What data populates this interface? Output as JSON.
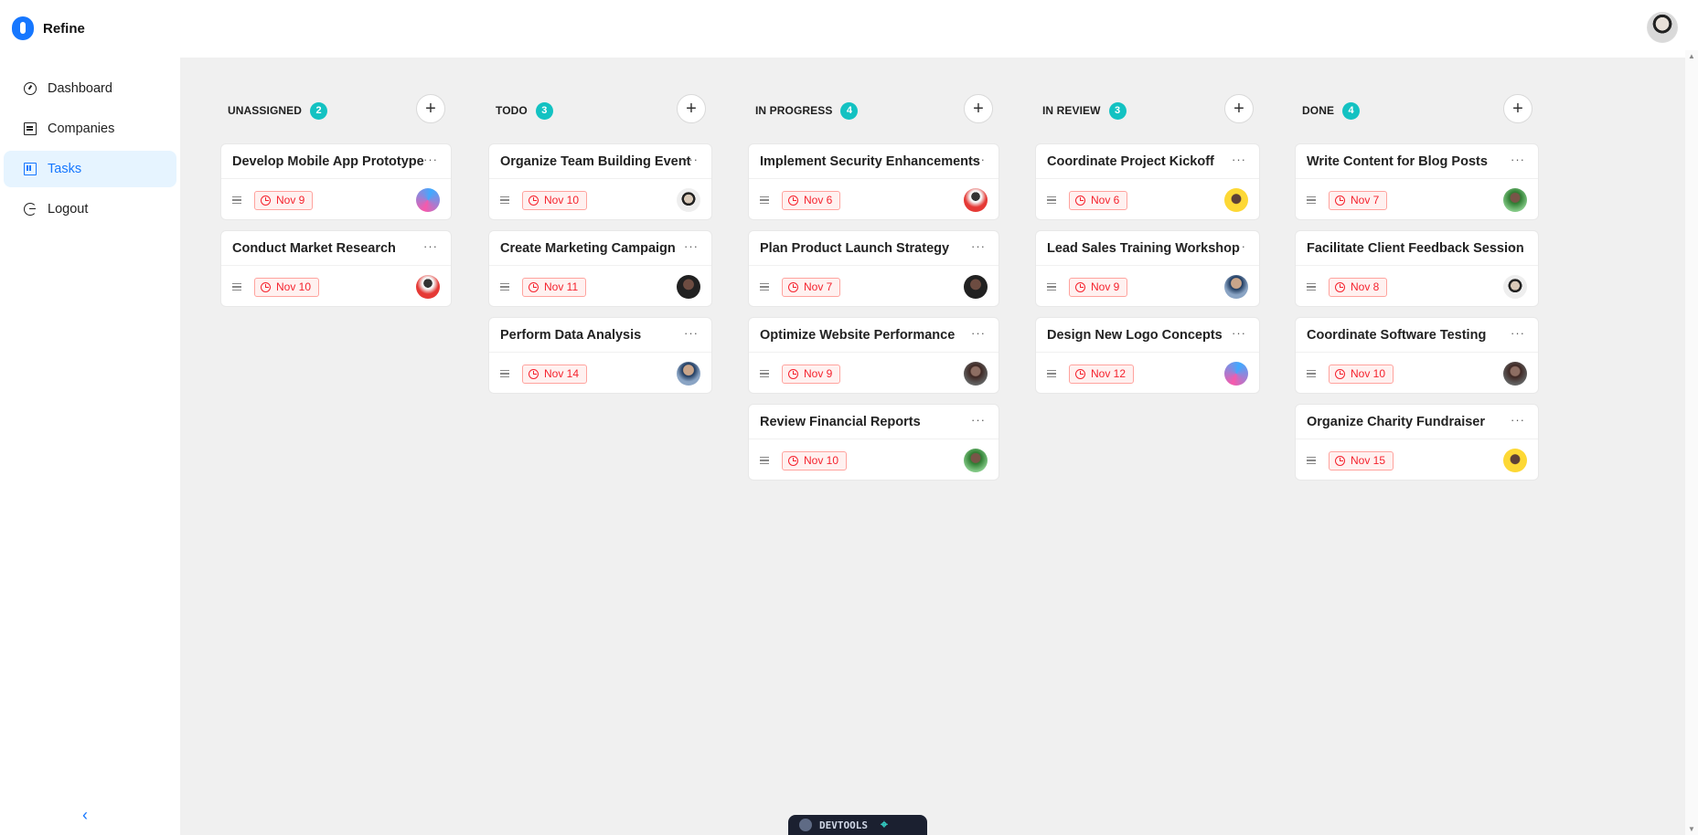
{
  "app": {
    "name": "Refine"
  },
  "sidebar": {
    "items": [
      {
        "label": "Dashboard",
        "icon": "dashboard-icon",
        "active": false
      },
      {
        "label": "Companies",
        "icon": "companies-icon",
        "active": false
      },
      {
        "label": "Tasks",
        "icon": "tasks-icon",
        "active": true
      },
      {
        "label": "Logout",
        "icon": "logout-icon",
        "active": false
      }
    ],
    "collapse_glyph": "‹"
  },
  "colors": {
    "accent": "#1677ff",
    "count_badge": "#13c2c2",
    "due_text": "#f5222d",
    "due_bg": "#fff1f0",
    "due_border": "#ffa39e",
    "board_bg": "#f0f0f0"
  },
  "columns": [
    {
      "title": "UNASSIGNED",
      "count": "2",
      "cards": [
        {
          "title": "Develop Mobile App Prototype",
          "due": "Nov 9",
          "avatar": "logo"
        },
        {
          "title": "Conduct Market Research",
          "due": "Nov 10",
          "avatar": "red-shirt"
        }
      ]
    },
    {
      "title": "TODO",
      "count": "3",
      "cards": [
        {
          "title": "Organize Team Building Event",
          "due": "Nov 10",
          "avatar": "cap"
        },
        {
          "title": "Create Marketing Campaign",
          "due": "Nov 11",
          "avatar": "dark"
        },
        {
          "title": "Perform Data Analysis",
          "due": "Nov 14",
          "avatar": "blue-suit"
        }
      ]
    },
    {
      "title": "IN PROGRESS",
      "count": "4",
      "cards": [
        {
          "title": "Implement Security Enhancements",
          "due": "Nov 6",
          "avatar": "red-shirt"
        },
        {
          "title": "Plan Product Launch Strategy",
          "due": "Nov 7",
          "avatar": "dark"
        },
        {
          "title": "Optimize Website Performance",
          "due": "Nov 9",
          "avatar": "dark-beard"
        },
        {
          "title": "Review Financial Reports",
          "due": "Nov 10",
          "avatar": "outdoor"
        }
      ]
    },
    {
      "title": "IN REVIEW",
      "count": "3",
      "cards": [
        {
          "title": "Coordinate Project Kickoff",
          "due": "Nov 6",
          "avatar": "yellow"
        },
        {
          "title": "Lead Sales Training Workshop",
          "due": "Nov 9",
          "avatar": "blue-suit"
        },
        {
          "title": "Design New Logo Concepts",
          "due": "Nov 12",
          "avatar": "logo"
        }
      ]
    },
    {
      "title": "DONE",
      "count": "4",
      "cards": [
        {
          "title": "Write Content for Blog Posts",
          "due": "Nov 7",
          "avatar": "outdoor"
        },
        {
          "title": "Facilitate Client Feedback Session",
          "due": "Nov 8",
          "avatar": "cap"
        },
        {
          "title": "Coordinate Software Testing",
          "due": "Nov 10",
          "avatar": "dark-beard"
        },
        {
          "title": "Organize Charity Fundraiser",
          "due": "Nov 15",
          "avatar": "yellow"
        }
      ]
    }
  ],
  "add_glyph": "+",
  "more_glyph": "···",
  "devtools": {
    "label": "DEVTOOLS"
  }
}
